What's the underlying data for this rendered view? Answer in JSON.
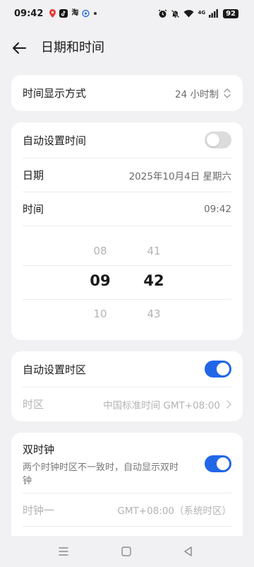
{
  "status_bar": {
    "time": "09:42",
    "left_icons": [
      "location-icon",
      "tiktok-icon",
      "taobao-icon",
      "app-icon",
      "dot-icon"
    ],
    "taobao_text": "淘",
    "right_icons": [
      "alarm-icon",
      "mute-icon",
      "wifi-icon",
      "signal-icon"
    ],
    "network": "4G",
    "battery": "92"
  },
  "header": {
    "title": "日期和时间"
  },
  "display_mode": {
    "label": "时间显示方式",
    "value": "24 小时制"
  },
  "time_card": {
    "auto_time_label": "自动设置时间",
    "auto_time_on": false,
    "date_label": "日期",
    "date_value": "2025年10月4日 星期六",
    "time_label": "时间",
    "time_value": "09:42",
    "picker": {
      "hours": [
        "08",
        "09",
        "10"
      ],
      "minutes": [
        "41",
        "42",
        "43"
      ]
    }
  },
  "timezone_card": {
    "auto_zone_label": "自动设置时区",
    "auto_zone_on": true,
    "zone_label": "时区",
    "zone_value": "中国标准时间 GMT+08:00"
  },
  "dual_clock_card": {
    "title": "双时钟",
    "subtitle_line1": "两个时钟时区不一致时，自动显示双时",
    "subtitle_line2": "钟",
    "enabled": true,
    "clock1_label": "时钟一",
    "clock1_value": "GMT+08:00（系统时区）"
  },
  "colors": {
    "accent": "#2266e8",
    "background": "#f1f1f3",
    "card": "#ffffff"
  }
}
